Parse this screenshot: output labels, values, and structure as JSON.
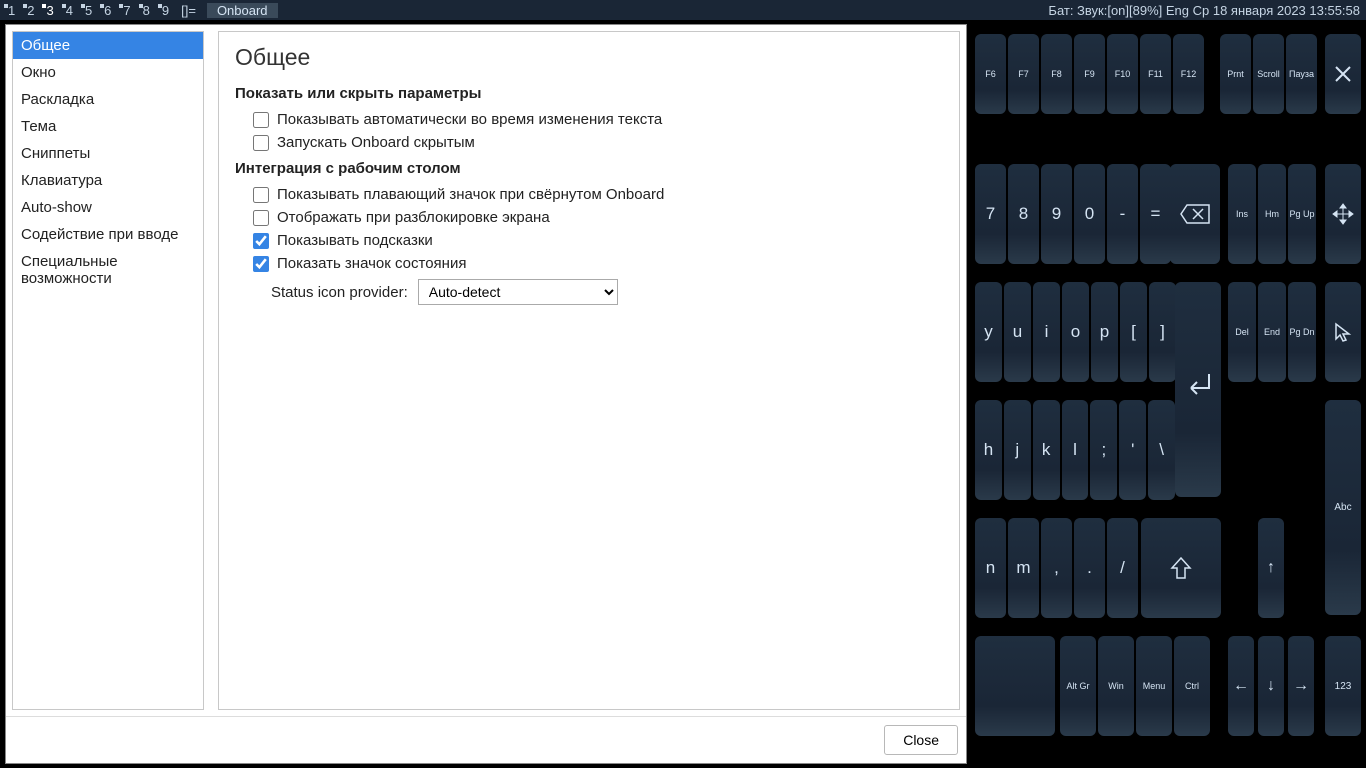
{
  "taskbar": {
    "workspaces": [
      "1",
      "2",
      "3",
      "4",
      "5",
      "6",
      "7",
      "8",
      "9"
    ],
    "active_workspace": 2,
    "extras": "[]=",
    "app_title": "Onboard",
    "status": "Бат: Звук:[on][89%] Eng Ср 18 января 2023 13:55:58"
  },
  "sidebar": {
    "items": [
      "Общее",
      "Окно",
      "Раскладка",
      "Тема",
      "Сниппеты",
      "Клавиатура",
      "Auto-show",
      "Содействие при вводе",
      "Специальные возможности"
    ],
    "selected": 0
  },
  "content": {
    "heading": "Общее",
    "section1_title": "Показать или скрыть параметры",
    "opt_auto_show": "Показывать автоматически во время изменения текста",
    "opt_start_hidden": "Запускать Onboard скрытым",
    "section2_title": "Интеграция с рабочим столом",
    "opt_floating_icon": "Показывать плавающий значок при свёрнутом Onboard",
    "opt_unlock_screen": "Отображать при разблокировке экрана",
    "opt_tooltips": "Показывать подсказки",
    "opt_status_icon": "Показать значок состояния",
    "status_provider_label": "Status icon provider:",
    "status_provider_value": "Auto-detect"
  },
  "footer": {
    "close_label": "Close"
  },
  "keyboard": {
    "fn_row": [
      "F6",
      "F7",
      "F8",
      "F9",
      "F10",
      "F11",
      "F12"
    ],
    "fn_extras": [
      "Prnt",
      "Scroll",
      "Пауза"
    ],
    "num_row": [
      "7",
      "8",
      "9",
      "0",
      "-",
      "="
    ],
    "nav1": [
      "Ins",
      "Hm",
      "Pg Up"
    ],
    "letter_row1": [
      "y",
      "u",
      "i",
      "o",
      "p",
      "[",
      "]"
    ],
    "nav2": [
      "Del",
      "End",
      "Pg Dn"
    ],
    "letter_row2": [
      "h",
      "j",
      "k",
      "l",
      ";",
      "'",
      "\\"
    ],
    "letter_row3": [
      "n",
      "m",
      ",",
      ".",
      "/"
    ],
    "mods": [
      "Alt Gr",
      "Win",
      "Menu",
      "Ctrl"
    ],
    "side_labels": {
      "abc": "Abc",
      "num": "123"
    }
  }
}
